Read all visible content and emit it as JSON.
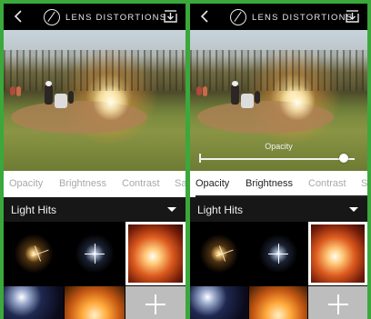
{
  "app": {
    "title": "LENS DISTORTIONS"
  },
  "tabs": [
    "Opacity",
    "Brightness",
    "Contrast",
    "Sa"
  ],
  "category": {
    "selected": "Light Hits"
  },
  "right_screen": {
    "active_tab_index": 0,
    "opacity_label": "Opacity",
    "opacity_value": 0.93
  },
  "icons": {
    "back": "chevron-left-icon",
    "logo": "lens-logo-icon",
    "download": "download-icon",
    "dropdown": "chevron-down-icon",
    "add": "plus-icon"
  },
  "colors": {
    "background": "#3aa83a",
    "bar": "#000000",
    "category_bar": "#171717",
    "tab_inactive": "#a8a8a8",
    "tab_active": "#222222"
  }
}
